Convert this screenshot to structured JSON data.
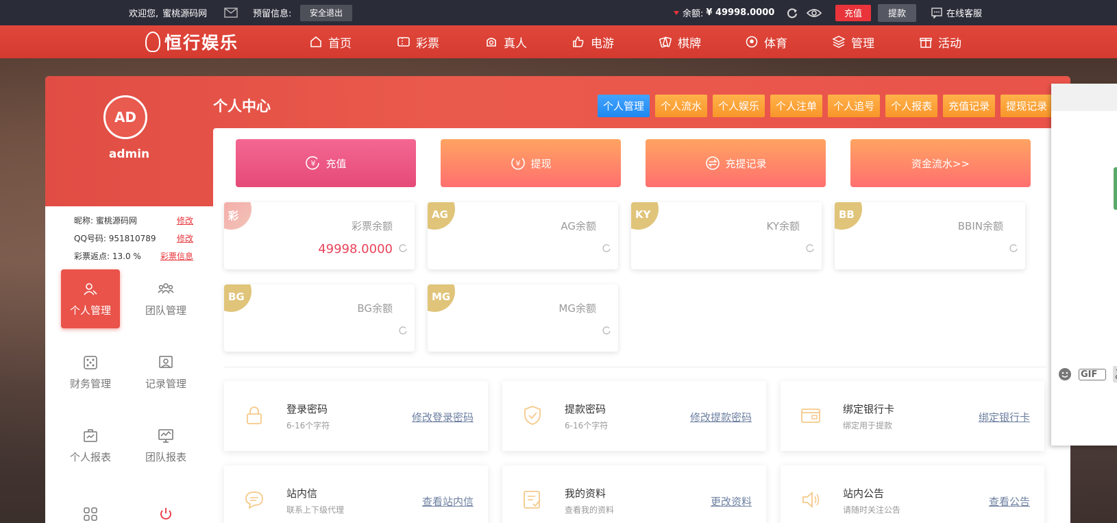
{
  "topbar": {
    "welcome": "欢迎您,",
    "username": "蜜桃源码网",
    "reserved_label": "预留信息:",
    "logout": "安全退出",
    "balance_label": "余额:",
    "balance_value": "¥ 49998.0000",
    "recharge": "充值",
    "withdraw": "提款",
    "support": "在线客服"
  },
  "nav": {
    "logo": "恒行娱乐",
    "items": [
      {
        "label": "首页",
        "icon": "home-icon"
      },
      {
        "label": "彩票",
        "icon": "ticket-icon"
      },
      {
        "label": "真人",
        "icon": "live-icon"
      },
      {
        "label": "电游",
        "icon": "thumb-icon"
      },
      {
        "label": "棋牌",
        "icon": "cards-icon"
      },
      {
        "label": "体育",
        "icon": "ball-icon"
      },
      {
        "label": "管理",
        "icon": "layers-icon"
      },
      {
        "label": "活动",
        "icon": "gift-icon"
      }
    ]
  },
  "sidebar": {
    "avatar": "AD",
    "name": "admin",
    "nickname_label": "昵称:",
    "nickname": "蜜桃源码网",
    "qq_label": "QQ号码:",
    "qq": "951810789",
    "rebate_label": "彩票返点:",
    "rebate": "13.0 %",
    "edit": "修改",
    "rebate_link": "彩票信息",
    "menu": [
      {
        "label": "个人管理",
        "icon": "user-icon"
      },
      {
        "label": "团队管理",
        "icon": "team-icon"
      },
      {
        "label": "财务管理",
        "icon": "dice-icon"
      },
      {
        "label": "记录管理",
        "icon": "record-icon"
      },
      {
        "label": "个人报表",
        "icon": "report-icon"
      },
      {
        "label": "团队报表",
        "icon": "monitor-icon"
      },
      {
        "label": "",
        "icon": "grid-icon"
      },
      {
        "label": "",
        "icon": "power-icon"
      }
    ]
  },
  "page": {
    "title": "个人中心",
    "tabs": [
      "个人管理",
      "个人流水",
      "个人娱乐",
      "个人注单",
      "个人追号",
      "个人报表",
      "充值记录",
      "提现记录"
    ],
    "actions": [
      "充值",
      "提现",
      "充提记录",
      "资金流水>>"
    ],
    "balances": [
      {
        "tag": "彩",
        "name": "彩票余额",
        "value": "49998.0000"
      },
      {
        "tag": "AG",
        "name": "AG余额",
        "value": ""
      },
      {
        "tag": "KY",
        "name": "KY余额",
        "value": ""
      },
      {
        "tag": "BB",
        "name": "BBIN余额",
        "value": ""
      },
      {
        "tag": "BG",
        "name": "BG余额",
        "value": ""
      },
      {
        "tag": "MG",
        "name": "MG余额",
        "value": ""
      }
    ],
    "security": [
      {
        "title": "登录密码",
        "sub": "6-16个字符",
        "link": "修改登录密码",
        "icon": "lock-icon"
      },
      {
        "title": "提款密码",
        "sub": "6-16个字符",
        "link": "修改提款密码",
        "icon": "shield-icon"
      },
      {
        "title": "绑定银行卡",
        "sub": "绑定用于提款",
        "link": "绑定银行卡",
        "icon": "card-icon"
      },
      {
        "title": "站内信",
        "sub": "联系上下级代理",
        "link": "查看站内信",
        "icon": "chat-icon"
      },
      {
        "title": "我的资料",
        "sub": "查看我的资料",
        "link": "更改资料",
        "icon": "profile-icon"
      },
      {
        "title": "站内公告",
        "sub": "请随时关注公告",
        "link": "查看公告",
        "icon": "speaker-icon"
      }
    ]
  },
  "float": {
    "gif": "GIF"
  },
  "colors": {
    "accent_red": "#e8343a",
    "nav_red": "#d43a2f",
    "active_tab": "#1e88f0",
    "tab_orange": "#f8962a"
  }
}
